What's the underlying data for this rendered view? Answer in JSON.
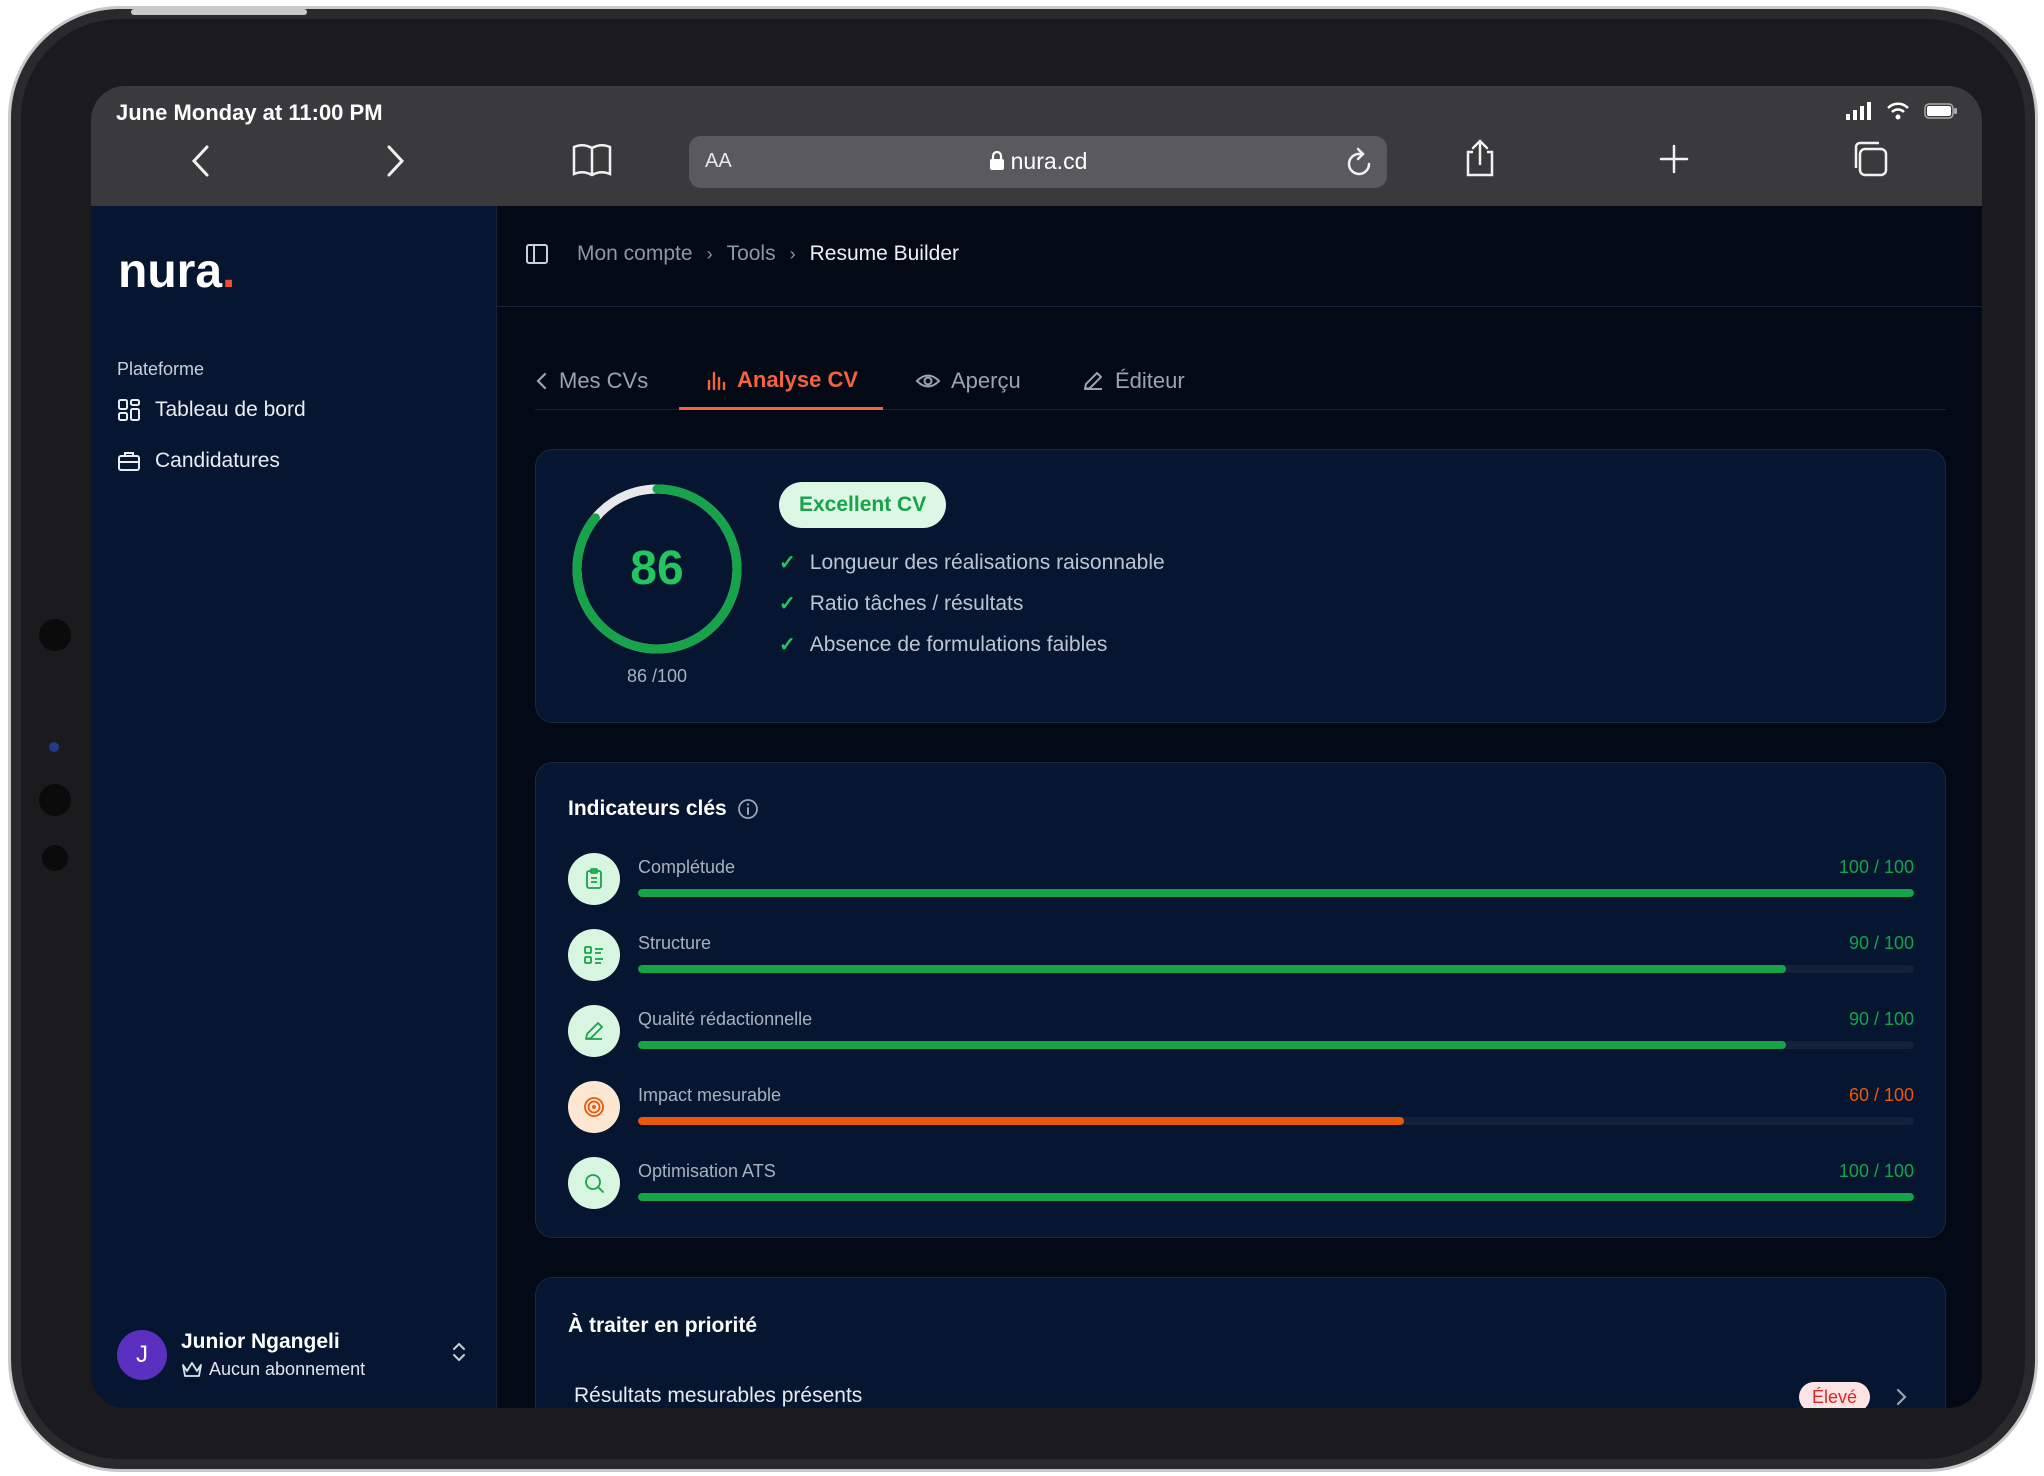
{
  "status_bar": {
    "time": "June Monday at 11:00 PM"
  },
  "browser": {
    "aa_label": "AA",
    "url": "nura.cd"
  },
  "sidebar": {
    "logo": "nura",
    "logo_dot": ".",
    "section": "Plateforme",
    "items": [
      {
        "label": "Tableau de bord",
        "icon": "dashboard-grid-icon"
      },
      {
        "label": "Candidatures",
        "icon": "briefcase-icon"
      }
    ],
    "user": {
      "initial": "J",
      "name": "Junior Ngangeli",
      "plan": "Aucun abonnement"
    }
  },
  "breadcrumb": [
    "Mon compte",
    "Tools",
    "Resume Builder"
  ],
  "tabs": [
    {
      "label": "Mes CVs",
      "icon": "chevron-left-icon"
    },
    {
      "label": "Analyse CV",
      "icon": "bar-chart-icon",
      "active": true
    },
    {
      "label": "Aperçu",
      "icon": "eye-icon"
    },
    {
      "label": "Éditeur",
      "icon": "pencil-icon"
    }
  ],
  "score": {
    "value": "86",
    "percent": 86,
    "sub": "86 /100",
    "badge": "Excellent CV",
    "checks": [
      "Longueur des réalisations raisonnable",
      "Ratio tâches / résultats",
      "Absence de formulations faibles"
    ]
  },
  "indicators": {
    "title": "Indicateurs clés",
    "items": [
      {
        "label": "Complétude",
        "value": "100 / 100",
        "percent": 100,
        "status": "good",
        "icon": "clipboard-icon"
      },
      {
        "label": "Structure",
        "value": "90 / 100",
        "percent": 90,
        "status": "good",
        "icon": "list-layout-icon"
      },
      {
        "label": "Qualité rédactionnelle",
        "value": "90 / 100",
        "percent": 90,
        "status": "good",
        "icon": "pen-icon"
      },
      {
        "label": "Impact mesurable",
        "value": "60 / 100",
        "percent": 60,
        "status": "warn",
        "icon": "target-icon"
      },
      {
        "label": "Optimisation ATS",
        "value": "100 / 100",
        "percent": 100,
        "status": "good",
        "icon": "search-icon"
      }
    ]
  },
  "priority": {
    "title": "À traiter en priorité",
    "items": [
      {
        "label": "Résultats mesurables présents",
        "badge": "Élevé"
      }
    ]
  },
  "colors": {
    "green": "#16a34a",
    "orange": "#ea580c",
    "accent": "#f2633f"
  }
}
